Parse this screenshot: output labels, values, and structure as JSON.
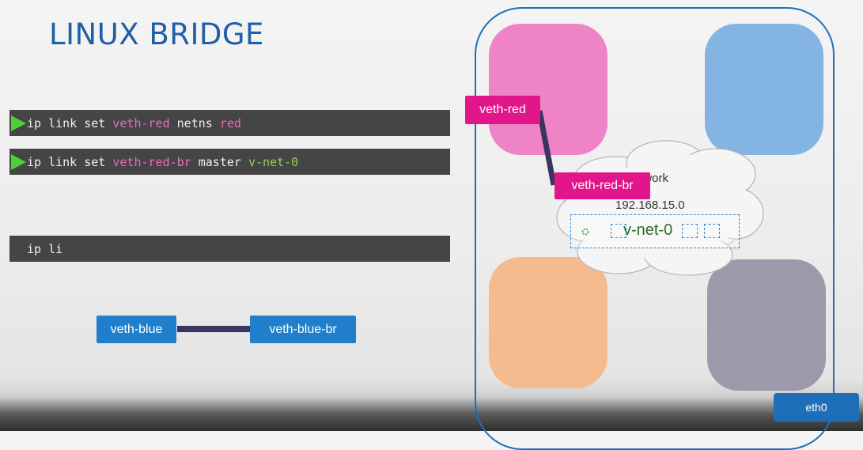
{
  "title": "LINUX BRIDGE",
  "commands": [
    {
      "tokens": [
        {
          "text": "ip link set ",
          "style": "plain"
        },
        {
          "text": "veth-red",
          "style": "pink"
        },
        {
          "text": " netns ",
          "style": "plain"
        },
        {
          "text": "red",
          "style": "pink"
        }
      ]
    },
    {
      "tokens": [
        {
          "text": "ip link set ",
          "style": "plain"
        },
        {
          "text": "veth-red-br",
          "style": "pink"
        },
        {
          "text": " master ",
          "style": "plain"
        },
        {
          "text": "v-net-0",
          "style": "green"
        }
      ]
    },
    {
      "tokens": [
        {
          "text": "ip li",
          "style": "plain"
        }
      ]
    }
  ],
  "blue_link": {
    "left": "veth-blue",
    "right": "veth-blue-br"
  },
  "red_link": {
    "left": "veth-red",
    "right": "veth-red-br"
  },
  "network": {
    "label": "Network",
    "subnet": "192.168.15.0",
    "bridge": "v-net-0"
  },
  "host_interface": "eth0",
  "colors": {
    "title": "#1f5fa8",
    "ns_red": "#ee83c6",
    "ns_blue": "#84b4e2",
    "ns_orange": "#f4bb8f",
    "ns_grey": "#9d99ab",
    "iface_blue": "#1f7fcc",
    "iface_pink": "#e0168a",
    "host_border": "#1f6fb8",
    "cable": "#3a3560"
  }
}
